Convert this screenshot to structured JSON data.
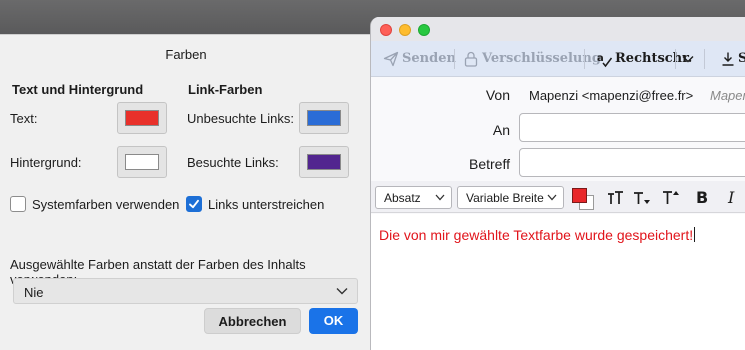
{
  "dialog": {
    "title": "Farben",
    "text_bg_heading": "Text und Hintergrund",
    "link_heading": "Link-Farben",
    "text_label": "Text:",
    "background_label": "Hintergrund:",
    "unvisited_label": "Unbesuchte Links:",
    "visited_label": "Besuchte Links:",
    "system_colors_label": "Systemfarben verwenden",
    "underline_links_label": "Links unterstreichen",
    "override_label": "Ausgewählte Farben anstatt der Farben des Inhalts verwenden:",
    "override_value": "Nie",
    "cancel_label": "Abbrechen",
    "ok_label": "OK",
    "colors": {
      "text": "#e8302a",
      "background": "#ffffff",
      "unvisited": "#2a6cd6",
      "visited": "#52258f"
    },
    "system_colors_checked": false,
    "underline_links_checked": true
  },
  "compose": {
    "toolbar": {
      "send_label": "Senden",
      "encryption_label": "Verschlüsselung",
      "spelling_label": "Rechtschr.",
      "save_label": "S"
    },
    "from_label": "Von",
    "from_value": "Mapenzi <mapenzi@free.fr>",
    "from_ghost": "Mapenzi",
    "to_label": "An",
    "subject_label": "Betreff",
    "format": {
      "paragraph_label": "Absatz",
      "font_label": "Variable Breite",
      "text_color": "#e8272a",
      "bg_color": "#ffffff"
    },
    "body_text": "Die von mir gewählte Textfarbe wurde gespeichert!",
    "body_color": "#e1141b"
  },
  "icons": [
    "send-icon",
    "lock-icon",
    "spellcheck-icon",
    "chevron-down-icon",
    "download-icon",
    "font-size-icon",
    "font-smaller-icon",
    "font-larger-icon",
    "bold-icon",
    "italic-icon",
    "checkmark-icon"
  ]
}
